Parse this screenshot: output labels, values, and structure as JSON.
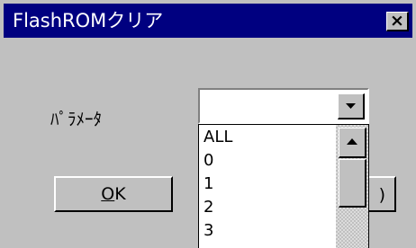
{
  "window": {
    "title": "FlashROMクリア",
    "close_glyph": "×"
  },
  "form": {
    "parameter_label": "ﾊﾟﾗﾒｰﾀ",
    "combo_value": "",
    "dropdown_options": [
      "ALL",
      "0",
      "1",
      "2",
      "3"
    ]
  },
  "buttons": {
    "ok_mnemonic": "O",
    "ok_rest": "K",
    "cancel_partial": ")"
  },
  "icons": {
    "combo_arrow": "triangle-down-icon",
    "scroll_up_arrow": "triangle-up-icon",
    "close": "close-icon"
  },
  "colors": {
    "titlebar": "#000080",
    "face": "#c0c0c0",
    "title_text": "#ffffff"
  }
}
